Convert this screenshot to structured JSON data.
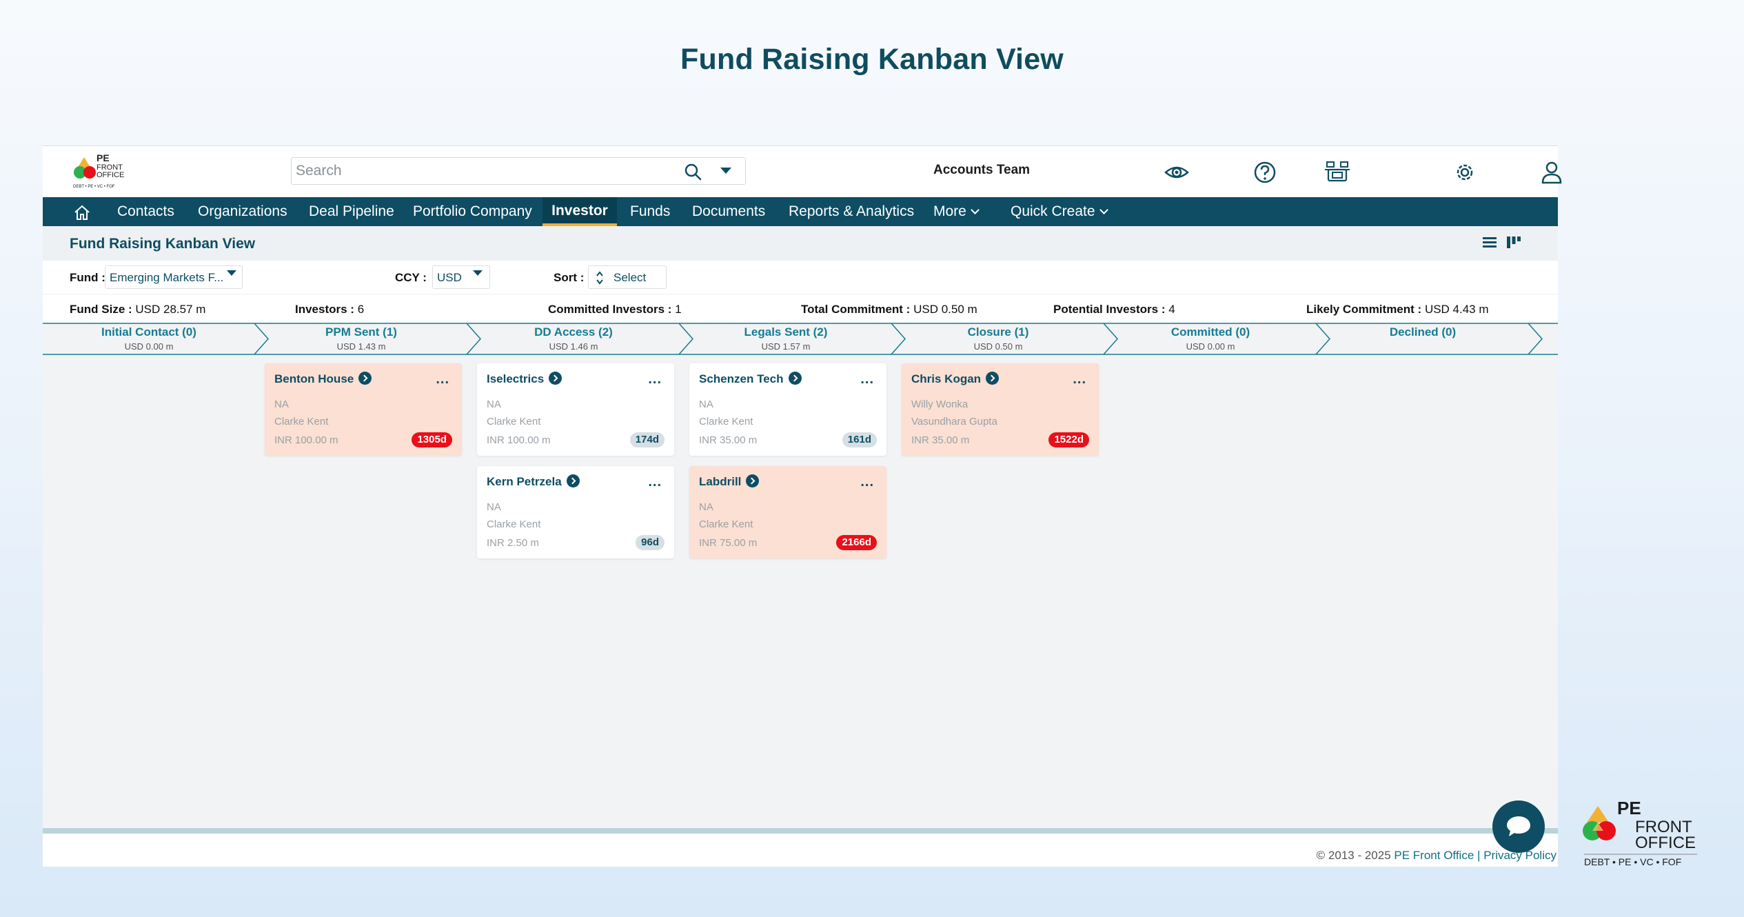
{
  "page_title": "Fund Raising Kanban View",
  "topbar": {
    "logo_alt": "PE FRONT OFFICE",
    "search_placeholder": "Search",
    "account_name": "Accounts Team",
    "icons": [
      "eye-icon",
      "help-icon",
      "devices-icon",
      "settings-icon",
      "user-icon"
    ]
  },
  "nav": {
    "items": [
      "Contacts",
      "Organizations",
      "Deal Pipeline",
      "Portfolio Company",
      "Investor",
      "Funds",
      "Documents",
      "Reports & Analytics",
      "More",
      "Quick Create"
    ],
    "active": "Investor"
  },
  "view": {
    "title": "Fund Raising Kanban View"
  },
  "filters": {
    "fund_label": "Fund :",
    "fund_value": "Emerging Markets F...",
    "ccy_label": "CCY :",
    "ccy_value": "USD",
    "sort_label": "Sort :",
    "sort_value": "Select"
  },
  "stats": {
    "fund_size_label": "Fund Size :",
    "fund_size_value": "USD 28.57 m",
    "investors_label": "Investors :",
    "investors_value": "6",
    "committed_investors_label": "Committed Investors :",
    "committed_investors_value": "1",
    "total_commitment_label": "Total Commitment :",
    "total_commitment_value": "USD 0.50 m",
    "potential_investors_label": "Potential Investors :",
    "potential_investors_value": "4",
    "likely_commitment_label": "Likely Commitment :",
    "likely_commitment_value": "USD 4.43 m"
  },
  "stages": [
    {
      "name": "Initial Contact (0)",
      "amount": "USD 0.00 m"
    },
    {
      "name": "PPM Sent (1)",
      "amount": "USD 1.43 m"
    },
    {
      "name": "DD Access (2)",
      "amount": "USD 1.46 m"
    },
    {
      "name": "Legals Sent (2)",
      "amount": "USD 1.57 m"
    },
    {
      "name": "Closure (1)",
      "amount": "USD 0.50 m"
    },
    {
      "name": "Committed (0)",
      "amount": "USD 0.00 m"
    },
    {
      "name": "Declined (0)",
      "amount": ""
    }
  ],
  "cards": [
    {
      "title": "Benton House",
      "line1": "NA",
      "line2": "Clarke Kent",
      "amount": "INR 100.00 m",
      "age": "1305d",
      "style": "salmon",
      "badge": "red",
      "stage": 1,
      "row": 0
    },
    {
      "title": "Iselectrics",
      "line1": "NA",
      "line2": "Clarke Kent",
      "amount": "INR 100.00 m",
      "age": "174d",
      "style": "white",
      "badge": "grey",
      "stage": 2,
      "row": 0
    },
    {
      "title": "Kern Petrzela",
      "line1": "NA",
      "line2": "Clarke Kent",
      "amount": "INR 2.50 m",
      "age": "96d",
      "style": "white",
      "badge": "grey",
      "stage": 2,
      "row": 1
    },
    {
      "title": "Schenzen Tech",
      "line1": "NA",
      "line2": "Clarke Kent",
      "amount": "INR 35.00 m",
      "age": "161d",
      "style": "white",
      "badge": "grey",
      "stage": 3,
      "row": 0
    },
    {
      "title": "Labdrill",
      "line1": "NA",
      "line2": "Clarke Kent",
      "amount": "INR 75.00 m",
      "age": "2166d",
      "style": "salmon",
      "badge": "red",
      "stage": 3,
      "row": 1
    },
    {
      "title": "Chris Kogan",
      "line1": "Willy Wonka",
      "line2": "Vasundhara Gupta",
      "amount": "INR 35.00 m",
      "age": "1522d",
      "style": "salmon",
      "badge": "red",
      "stage": 4,
      "row": 0
    }
  ],
  "card_menu": "...",
  "footer": {
    "copyright": "© 2013 - 2025",
    "company": "PE Front Office",
    "separator": "|",
    "privacy": "Privacy Policy"
  },
  "brand": {
    "pe": "PE",
    "front": "FRONT",
    "office": "OFFICE",
    "tagline": "DEBT • PE • VC • FOF"
  },
  "colors": {
    "primary": "#0e4d63",
    "accent": "#f2b134",
    "badge_red": "#e8101a",
    "card_salmon": "#fbe0d3"
  }
}
